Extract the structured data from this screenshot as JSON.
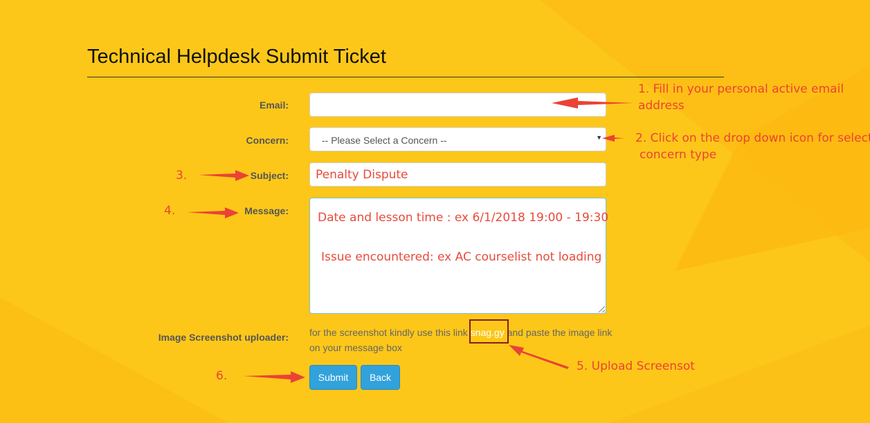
{
  "page": {
    "title": "Technical Helpdesk Submit Ticket"
  },
  "form": {
    "email": {
      "label": "Email:",
      "value": ""
    },
    "concern": {
      "label": "Concern:",
      "selected": "-- Please Select a Concern --"
    },
    "subject": {
      "label": "Subject:",
      "value": "Penalty Dispute"
    },
    "message": {
      "label": "Message:",
      "line_1": "Date and lesson time : ex 6/1/2018 19:00 - 19:30",
      "line_2": "Issue encountered: ex AC courselist not loading"
    },
    "uploader": {
      "label": "Image Screenshot uploader:",
      "text_before": "for the screenshot kindly use this link ",
      "link_text": "snag.gy",
      "text_after": " and paste the image link on your message box"
    },
    "buttons": {
      "submit": "Submit",
      "back": "Back"
    }
  },
  "annotations": {
    "note_1_line_1": "1. Fill in your personal active email",
    "note_1_line_2": "address",
    "note_2_line_1": "2. Click on the drop down icon for select",
    "note_2_line_2": "concern type",
    "step_3": "3.",
    "step_4": "4.",
    "note_5": "5. Upload Screensot",
    "step_6": "6."
  },
  "colors": {
    "background": "#fdc719",
    "button": "#31a2dc",
    "annotation_red": "#ea4335",
    "highlight_box": "#8b1a1a"
  },
  "icons": {
    "concern_dropdown": "chevron-down-icon",
    "annotation_arrows": "red-arrow-icon"
  }
}
